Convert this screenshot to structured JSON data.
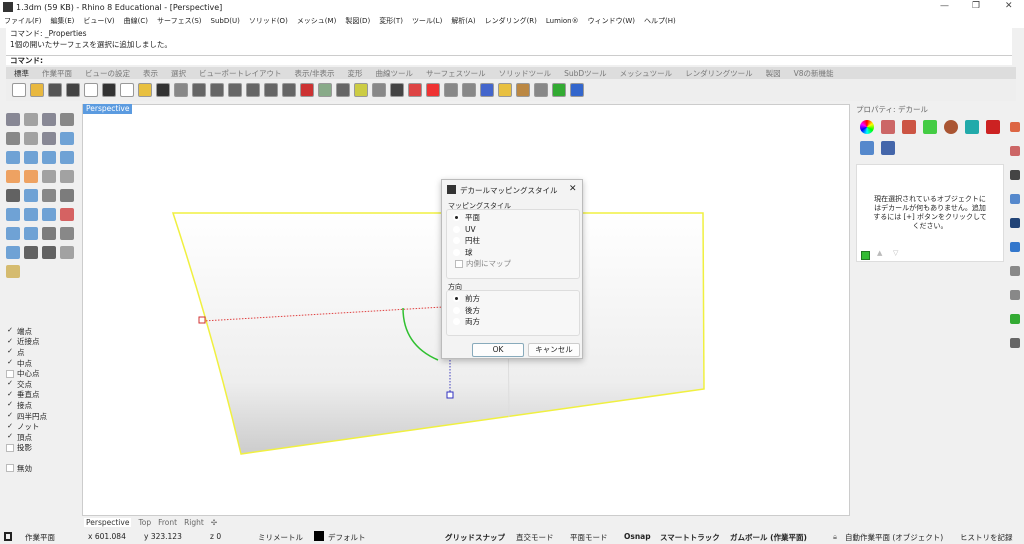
{
  "window": {
    "title": "1.3dm (59 KB) - Rhino 8 Educational - [Perspective]",
    "minimize": "—",
    "restore": "❐",
    "close": "✕"
  },
  "menu": [
    "ファイル(F)",
    "編集(E)",
    "ビュー(V)",
    "曲線(C)",
    "サーフェス(S)",
    "SubD(U)",
    "ソリッド(O)",
    "メッシュ(M)",
    "製図(D)",
    "変形(T)",
    "ツール(L)",
    "解析(A)",
    "レンダリング(R)",
    "Lumion®",
    "ウィンドウ(W)",
    "ヘルプ(H)"
  ],
  "command": {
    "history": [
      "コマンド: _Properties",
      "1個の開いたサーフェスを選択に追加しました。"
    ],
    "prompt": "コマンド:"
  },
  "toolbar_tabs": [
    "標準",
    "作業平面",
    "ビューの設定",
    "表示",
    "選択",
    "ビューポートレイアウト",
    "表示/非表示",
    "変形",
    "曲線ツール",
    "サーフェスツール",
    "ソリッドツール",
    "SubDツール",
    "メッシュツール",
    "レンダリングツール",
    "製図",
    "V8の新機能"
  ],
  "osnap": [
    {
      "label": "端点",
      "checked": true
    },
    {
      "label": "近接点",
      "checked": true
    },
    {
      "label": "点",
      "checked": true
    },
    {
      "label": "中点",
      "checked": true
    },
    {
      "label": "中心点",
      "checked": false
    },
    {
      "label": "交点",
      "checked": true
    },
    {
      "label": "垂直点",
      "checked": true
    },
    {
      "label": "接点",
      "checked": true
    },
    {
      "label": "四半円点",
      "checked": true
    },
    {
      "label": "ノット",
      "checked": true
    },
    {
      "label": "頂点",
      "checked": true
    },
    {
      "label": "投影",
      "checked": false
    }
  ],
  "osnap_disable": "無効",
  "viewport": {
    "label": "Perspective",
    "tabs": [
      "Perspective",
      "Top",
      "Front",
      "Right"
    ],
    "add_tab": "✣"
  },
  "dialog": {
    "title": "デカールマッピングスタイル",
    "close": "✕",
    "style_group": "マッピングスタイル",
    "styles": [
      {
        "label": "平面",
        "selected": true
      },
      {
        "label": "UV",
        "selected": false
      },
      {
        "label": "円柱",
        "selected": false
      },
      {
        "label": "球",
        "selected": false
      }
    ],
    "map_inside": "内側にマップ",
    "dir_group": "方向",
    "directions": [
      {
        "label": "前方",
        "selected": true
      },
      {
        "label": "後方",
        "selected": false
      },
      {
        "label": "両方",
        "selected": false
      }
    ],
    "ok": "OK",
    "cancel": "キャンセル"
  },
  "properties": {
    "title": "プロパティ: デカール",
    "message": "現在選択されているオブジェクトにはデカールが何もありません。追加するには [+] ボタンをクリックしてください。"
  },
  "status": {
    "cplane": "作業平面",
    "x": "x 601.084",
    "y": "y 323.123",
    "z": "z 0",
    "units": "ミリメートル",
    "layer": "デフォルト",
    "grid_snap": "グリッドスナップ",
    "ortho": "直交モード",
    "planar": "平面モード",
    "osnap": "Osnap",
    "smarttrack": "スマートトラック",
    "gumball": "ガムボール (作業平面)",
    "auto_cplane": "自動作業平面 (オブジェクト)",
    "history": "ヒストリを記録"
  },
  "colors": {
    "accent": "#5b9be0",
    "surface_edge": "#f0f040",
    "layer": "#000000"
  }
}
